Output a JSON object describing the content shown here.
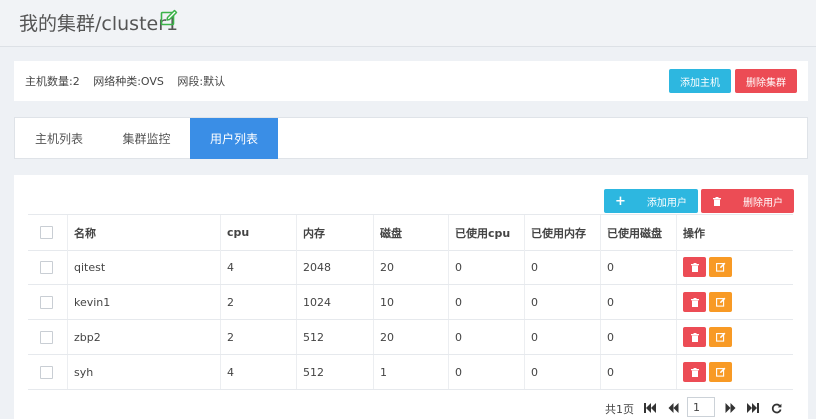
{
  "header": {
    "title": "我的集群/cluster1",
    "edit_icon": "edit-icon"
  },
  "info": {
    "host_count": "主机数量:2",
    "network_type": "网络种类:OVS",
    "network_segment": "网段:默认",
    "add_host_label": "添加主机",
    "delete_cluster_label": "删除集群"
  },
  "tabs": [
    {
      "label": "主机列表",
      "active": false
    },
    {
      "label": "集群监控",
      "active": false
    },
    {
      "label": "用户列表",
      "active": true
    }
  ],
  "toolbar": {
    "add_user_label": "添加用户",
    "delete_user_label": "删除用户"
  },
  "table": {
    "columns": [
      "名称",
      "cpu",
      "内存",
      "磁盘",
      "已使用cpu",
      "已使用内存",
      "已使用磁盘",
      "操作"
    ],
    "rows": [
      {
        "name": "qitest",
        "cpu": "4",
        "mem": "2048",
        "disk": "20",
        "used_cpu": "0",
        "used_mem": "0",
        "used_disk": "0"
      },
      {
        "name": "kevin1",
        "cpu": "2",
        "mem": "1024",
        "disk": "10",
        "used_cpu": "0",
        "used_mem": "0",
        "used_disk": "0"
      },
      {
        "name": "zbp2",
        "cpu": "2",
        "mem": "512",
        "disk": "20",
        "used_cpu": "0",
        "used_mem": "0",
        "used_disk": "0"
      },
      {
        "name": "syh",
        "cpu": "4",
        "mem": "512",
        "disk": "1",
        "used_cpu": "0",
        "used_mem": "0",
        "used_disk": "0"
      }
    ]
  },
  "pager": {
    "total": "共1页",
    "current_page": "1"
  },
  "colors": {
    "info": "#2db7e0",
    "danger": "#ec4c55",
    "warning": "#f89a25",
    "tab_active": "#3a8ee6",
    "edit_icon": "#3cb34a"
  }
}
